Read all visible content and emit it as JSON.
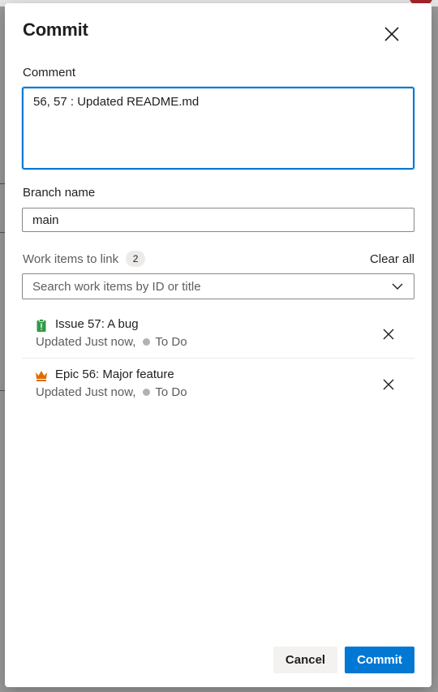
{
  "dialog": {
    "title": "Commit",
    "close_icon": "close-icon"
  },
  "comment": {
    "label": "Comment",
    "value": "56, 57 : Updated README.md"
  },
  "branch": {
    "label": "Branch name",
    "value": "main"
  },
  "work_items": {
    "label": "Work items to link",
    "count": "2",
    "clear_all_label": "Clear all",
    "search_placeholder": "Search work items by ID or title",
    "items": [
      {
        "icon": "issue-clipboard-icon",
        "icon_color": "#339947",
        "title": "Issue 57: A bug",
        "updated": "Updated Just now,",
        "state": "To Do",
        "state_color": "#b2b2b2"
      },
      {
        "icon": "epic-crown-icon",
        "icon_color": "#e06c00",
        "title": "Epic 56: Major feature",
        "updated": "Updated Just now,",
        "state": "To Do",
        "state_color": "#b2b2b2"
      }
    ]
  },
  "footer": {
    "cancel_label": "Cancel",
    "commit_label": "Commit"
  },
  "colors": {
    "accent": "#0078d4",
    "border": "#8a8886",
    "secondary_text": "#605e5c"
  }
}
